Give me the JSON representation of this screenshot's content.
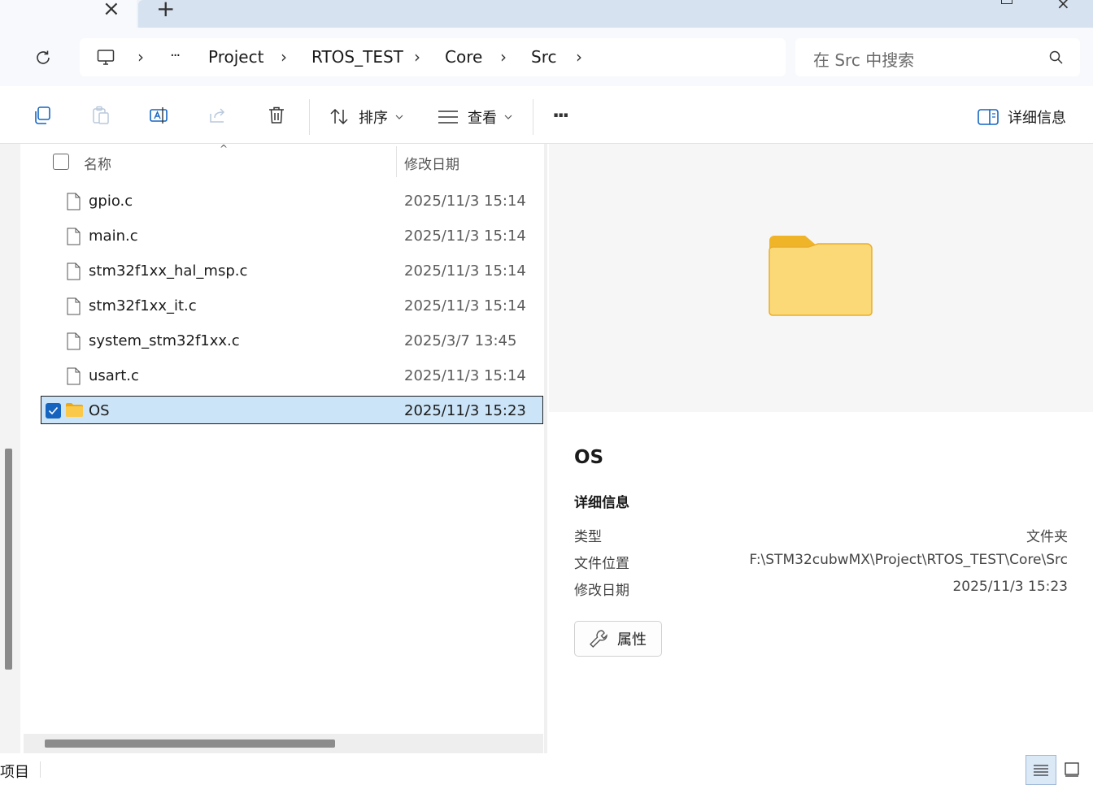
{
  "window": {
    "new_tab_label": "+",
    "close_tab_label": "×"
  },
  "address": {
    "breadcrumbs": [
      "Project",
      "RTOS_TEST",
      "Core",
      "Src"
    ],
    "ellipsis": "···",
    "search_placeholder": "在 Src 中搜索"
  },
  "toolbar": {
    "sort_label": "排序",
    "view_label": "查看",
    "more_label": "···",
    "details_label": "详细信息"
  },
  "list": {
    "columns": [
      "名称",
      "修改日期"
    ],
    "rows": [
      {
        "name": "gpio.c",
        "date": "2025/11/3 15:14",
        "kind": "file"
      },
      {
        "name": "main.c",
        "date": "2025/11/3 15:14",
        "kind": "file"
      },
      {
        "name": "stm32f1xx_hal_msp.c",
        "date": "2025/11/3 15:14",
        "kind": "file"
      },
      {
        "name": "stm32f1xx_it.c",
        "date": "2025/11/3 15:14",
        "kind": "file"
      },
      {
        "name": "system_stm32f1xx.c",
        "date": "2025/3/7 13:45",
        "kind": "file"
      },
      {
        "name": "usart.c",
        "date": "2025/11/3 15:14",
        "kind": "file"
      },
      {
        "name": "OS",
        "date": "2025/11/3 15:23",
        "kind": "folder",
        "selected": true
      }
    ]
  },
  "details": {
    "title": "OS",
    "section": "详细信息",
    "fields": [
      {
        "label": "类型",
        "value": "文件夹"
      },
      {
        "label": "文件位置",
        "value": "F:\\STM32cubwMX\\Project\\RTOS_TEST\\Core\\Src"
      },
      {
        "label": "修改日期",
        "value": "2025/11/3 15:23"
      }
    ],
    "properties_label": "属性"
  },
  "status": {
    "items_text": "项目"
  },
  "colors": {
    "accent": "#1565c0",
    "selection": "#cce4f7",
    "folder_yellow": "#fbc94a"
  }
}
